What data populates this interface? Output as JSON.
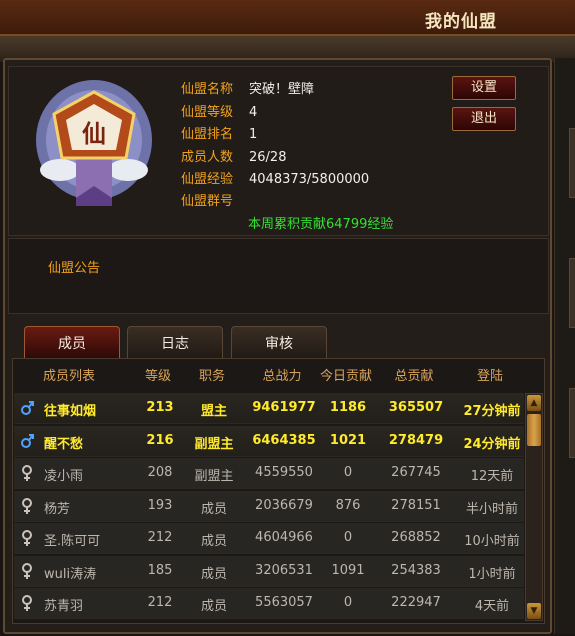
{
  "window": {
    "title": "我的仙盟"
  },
  "guild": {
    "fields": [
      {
        "key": "仙盟名称",
        "value": "突破！壁障"
      },
      {
        "key": "仙盟等级",
        "value": "4"
      },
      {
        "key": "仙盟排名",
        "value": "1"
      },
      {
        "key": "成员人数",
        "value": "26/28"
      },
      {
        "key": "仙盟经验",
        "value": "4048373/5800000"
      },
      {
        "key": "仙盟群号",
        "value": ""
      }
    ],
    "weekly": "本周累积贡献64799经验",
    "emblem_char": "仙"
  },
  "buttons": {
    "settings": "设置",
    "exit": "退出"
  },
  "notice": {
    "label": "仙盟公告"
  },
  "tabs": [
    "成员",
    "日志",
    "审核"
  ],
  "table": {
    "headers": [
      "成员列表",
      "等级",
      "职务",
      "总战力",
      "今日贡献",
      "总贡献",
      "登陆"
    ],
    "rows": [
      {
        "gender": "male",
        "online": true,
        "name": "往事如烟",
        "level": "213",
        "role": "盟主",
        "power": "9461977",
        "today": "1186",
        "total": "365507",
        "login": "27分钟前"
      },
      {
        "gender": "male",
        "online": true,
        "name": "醒不愁",
        "level": "216",
        "role": "副盟主",
        "power": "6464385",
        "today": "1021",
        "total": "278479",
        "login": "24分钟前"
      },
      {
        "gender": "female",
        "online": false,
        "name": "凌小雨",
        "level": "208",
        "role": "副盟主",
        "power": "4559550",
        "today": "0",
        "total": "267745",
        "login": "12天前"
      },
      {
        "gender": "female",
        "online": false,
        "name": "杨芳",
        "level": "193",
        "role": "成员",
        "power": "2036679",
        "today": "876",
        "total": "278151",
        "login": "半小时前"
      },
      {
        "gender": "female",
        "online": false,
        "name": "圣.陈可可",
        "level": "212",
        "role": "成员",
        "power": "4604966",
        "today": "0",
        "total": "268852",
        "login": "10小时前"
      },
      {
        "gender": "female",
        "online": false,
        "name": "wuli涛涛",
        "level": "185",
        "role": "成员",
        "power": "3206531",
        "today": "1091",
        "total": "254383",
        "login": "1小时前"
      },
      {
        "gender": "female",
        "online": false,
        "name": "苏青羽",
        "level": "212",
        "role": "成员",
        "power": "5563057",
        "today": "0",
        "total": "222947",
        "login": "4天前"
      }
    ]
  },
  "colors": {
    "label_orange": "#f2a21c",
    "online_yellow": "#ffea2c",
    "weekly_green": "#34e034",
    "male_blue": "#4fa3ff"
  }
}
